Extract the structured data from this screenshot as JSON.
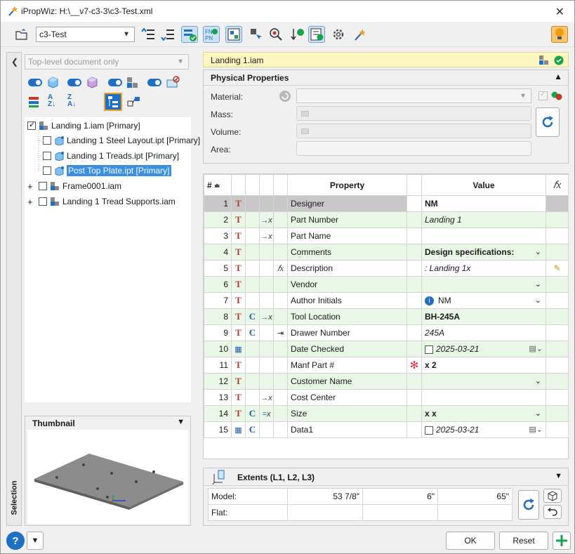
{
  "window": {
    "title": "iPropWiz: H:\\__v7-c3-3\\c3-Test.xml"
  },
  "toolbar": {
    "profile_value": "c3-Test"
  },
  "left": {
    "filter_value": "Top-level document only",
    "tree": [
      {
        "label": "Landing 1.iam [Primary]"
      },
      {
        "label": "Landing 1 Steel Layout.ipt [Primary]"
      },
      {
        "label": "Landing 1 Treads.ipt [Primary]"
      },
      {
        "label": "Post Top Plate.ipt [Primary]"
      },
      {
        "label": "Frame0001.iam"
      },
      {
        "label": "Landing 1 Tread Supports.iam"
      }
    ],
    "thumbnail_title": "Thumbnail",
    "side_tab": "Selection"
  },
  "doc": {
    "name": "Landing 1.iam"
  },
  "physical": {
    "title": "Physical Properties",
    "material_label": "Material:",
    "mass_label": "Mass:",
    "volume_label": "Volume:",
    "area_label": "Area:"
  },
  "grid": {
    "headers": {
      "num": "#",
      "property": "Property",
      "value": "Value"
    },
    "rows": [
      {
        "n": "1",
        "prop": "Designer",
        "value": "NM"
      },
      {
        "n": "2",
        "prop": "Part Number",
        "value": "Landing 1"
      },
      {
        "n": "3",
        "prop": "Part Name",
        "value": ""
      },
      {
        "n": "4",
        "prop": "Comments",
        "value": "Design specifications:"
      },
      {
        "n": "5",
        "prop": "Description",
        "value": ": Landing 1x"
      },
      {
        "n": "6",
        "prop": "Vendor",
        "value": ""
      },
      {
        "n": "7",
        "prop": "Author Initials",
        "value": "NM"
      },
      {
        "n": "8",
        "prop": "Tool Location",
        "value": "BH-245A"
      },
      {
        "n": "9",
        "prop": "Drawer Number",
        "value": "245A"
      },
      {
        "n": "10",
        "prop": "Date Checked",
        "value": "2025-03-21"
      },
      {
        "n": "11",
        "prop": "Manf Part #",
        "value": "x 2"
      },
      {
        "n": "12",
        "prop": "Customer Name",
        "value": ""
      },
      {
        "n": "13",
        "prop": "Cost Center",
        "value": ""
      },
      {
        "n": "14",
        "prop": "Size",
        "value": "x x"
      },
      {
        "n": "15",
        "prop": "Data1",
        "value": "2025-03-21"
      }
    ]
  },
  "extents": {
    "title": "Extents (L1, L2, L3)",
    "model_label": "Model:",
    "flat_label": "Flat:",
    "model_l1": "53 7/8\"",
    "model_l2": "6\"",
    "model_l3": "65\""
  },
  "footer": {
    "ok_label": "OK",
    "reset_label": "Reset"
  },
  "colors": {
    "accent": "#1f6fc5",
    "doc_bar": "#fdf6c0",
    "row_green": "#e8f7e6",
    "selected": "#cde3f5"
  }
}
